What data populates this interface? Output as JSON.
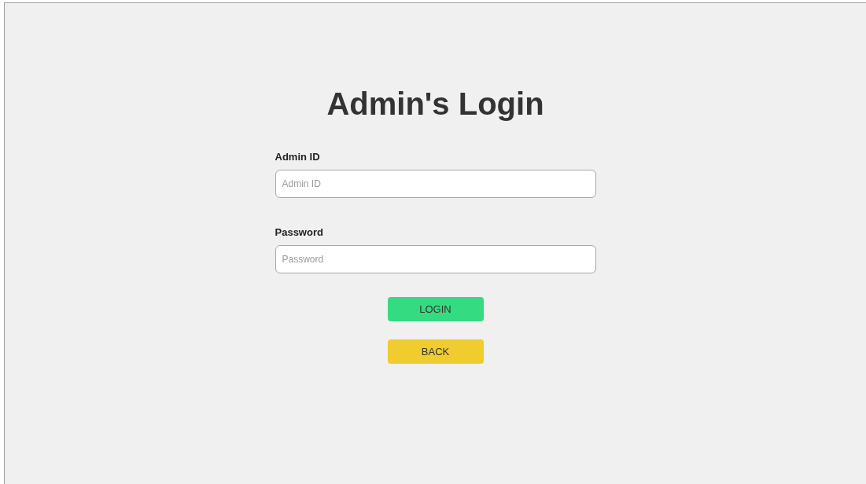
{
  "title": "Admin's Login",
  "fields": [
    {
      "label": "Admin ID",
      "placeholder": "Admin ID"
    },
    {
      "label": "Password",
      "placeholder": "Password"
    }
  ],
  "buttons": [
    {
      "label": "LOGIN",
      "kind": "primary"
    },
    {
      "label": "BACK",
      "kind": "secondary"
    }
  ]
}
